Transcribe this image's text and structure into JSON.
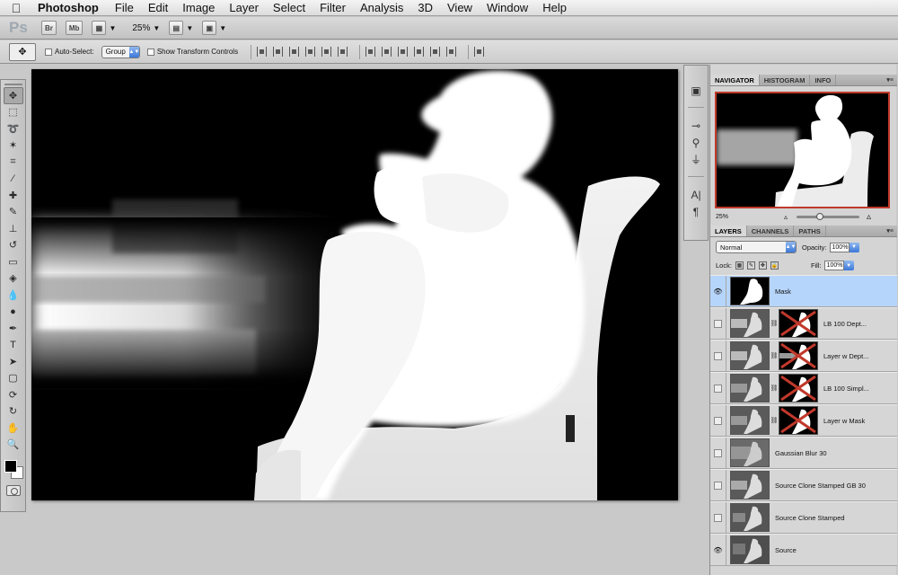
{
  "menubar": {
    "app": "Photoshop",
    "items": [
      "File",
      "Edit",
      "Image",
      "Layer",
      "Select",
      "Filter",
      "Analysis",
      "3D",
      "View",
      "Window",
      "Help"
    ]
  },
  "appbar": {
    "logo": "Ps",
    "bridge": "Br",
    "minibridge": "Mb",
    "zoom": "25%"
  },
  "options": {
    "auto_select_label": "Auto-Select:",
    "auto_select_value": "Group",
    "transform_label": "Show Transform Controls"
  },
  "navigator": {
    "tabs": [
      "NAVIGATOR",
      "HISTOGRAM",
      "INFO"
    ],
    "zoom": "25%"
  },
  "layers_panel": {
    "tabs": [
      "LAYERS",
      "CHANNELS",
      "PATHS"
    ],
    "blend_mode": "Normal",
    "opacity_label": "Opacity:",
    "opacity_value": "100%",
    "lock_label": "Lock:",
    "fill_label": "Fill:",
    "fill_value": "100%",
    "layers": [
      {
        "name": "Mask",
        "visible": true,
        "selected": true,
        "has_mask": false
      },
      {
        "name": "LB 100 Dept...",
        "visible": false,
        "selected": false,
        "has_mask": true
      },
      {
        "name": "Layer w Dept...",
        "visible": false,
        "selected": false,
        "has_mask": true
      },
      {
        "name": "LB 100 Simpl...",
        "visible": false,
        "selected": false,
        "has_mask": true
      },
      {
        "name": "Layer w Mask",
        "visible": false,
        "selected": false,
        "has_mask": true
      },
      {
        "name": "Gaussian Blur 30",
        "visible": false,
        "selected": false,
        "has_mask": false
      },
      {
        "name": "Source Clone Stamped GB 30",
        "visible": false,
        "selected": false,
        "has_mask": false
      },
      {
        "name": "Source Clone Stamped",
        "visible": false,
        "selected": false,
        "has_mask": false
      },
      {
        "name": "Source",
        "visible": true,
        "selected": false,
        "has_mask": false
      }
    ]
  },
  "colors": {
    "selected_row": "#b6d5fb",
    "navigator_frame": "#c03a2b",
    "mask_cross": "#c0392b"
  }
}
